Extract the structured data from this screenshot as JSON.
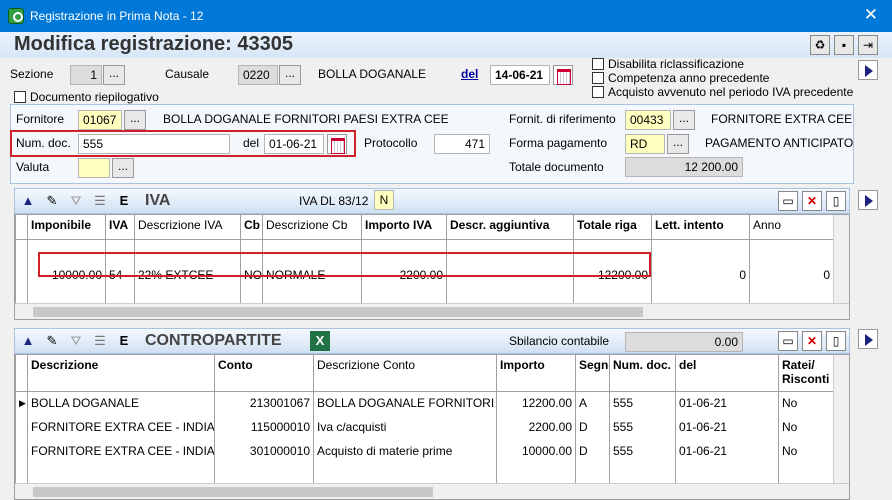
{
  "window": {
    "title": "Registrazione in Prima Nota - 12",
    "close_glyph": "✕"
  },
  "header": {
    "title": "Modifica registrazione:",
    "number": "43305",
    "sezione_label": "Sezione",
    "sezione_value": "1",
    "causale_label": "Causale",
    "causale_code": "0220",
    "causale_desc": "BOLLA DOGANALE",
    "del_label": "del",
    "date_value": "14-06-21",
    "doc_riepilogativo": "Documento riepilogativo",
    "checks": [
      "Disabilita riclassificazione",
      "Competenza anno precedente",
      "Acquisto avvenuto nel periodo IVA precedente"
    ]
  },
  "document": {
    "fornitore_label": "Fornitore",
    "fornitore_code": "01067",
    "fornitore_name": "BOLLA DOGANALE FORNITORI PAESI EXTRA CEE",
    "num_doc_label": "Num. doc.",
    "num_doc_value": "555",
    "del_label": "del",
    "doc_date": "01-06-21",
    "protocollo_label": "Protocollo",
    "protocollo_value": "471",
    "valuta_label": "Valuta",
    "valuta_value": "",
    "fornit_rif_label": "Fornit. di riferimento",
    "fornit_rif_code": "00433",
    "fornit_rif_name": "FORNITORE EXTRA CEE",
    "forma_pag_label": "Forma pagamento",
    "forma_pag_code": "RD",
    "forma_pag_desc": "PAGAMENTO ANTICIPATO",
    "totale_label": "Totale documento",
    "totale_value": "12 200.00"
  },
  "iva": {
    "title": "IVA",
    "dl_label": "IVA DL 83/12",
    "dl_value": "N",
    "columns": [
      "Imponibile",
      "IVA",
      "Descrizione IVA",
      "Cb",
      "Descrizione Cb",
      "Importo IVA",
      "Descr. aggiuntiva",
      "Totale riga",
      "Lett. intento",
      "Anno"
    ],
    "rows": [
      [
        "10000.00",
        "54",
        "22% EXTCEE",
        "NO",
        "NORMALE",
        "2200.00",
        "",
        "12200.00",
        "0",
        "0"
      ]
    ]
  },
  "contropartite": {
    "title": "CONTROPARTITE",
    "sbilancio_label": "Sbilancio contabile",
    "sbilancio_value": "0.00",
    "columns": [
      "Descrizione",
      "Conto",
      "Descrizione Conto",
      "Importo",
      "Segno",
      "Num. doc.",
      "del",
      "Ratei/ Risconti"
    ],
    "rows": [
      [
        "BOLLA DOGANALE",
        "213001067",
        "BOLLA DOGANALE FORNITORI P",
        "12200.00",
        "A",
        "555",
        "01-06-21",
        "No"
      ],
      [
        "FORNITORE EXTRA CEE - INDIA",
        "115000010",
        "Iva c/acquisti",
        "2200.00",
        "D",
        "555",
        "01-06-21",
        "No"
      ],
      [
        "FORNITORE EXTRA CEE - INDIA",
        "301000010",
        "Acquisto di materie prime",
        "10000.00",
        "D",
        "555",
        "01-06-21",
        "No"
      ]
    ]
  },
  "colors": {
    "titlebar": "#0078d7",
    "highlight": "#d0202a",
    "yellow_field": "#ffffc0"
  },
  "icons": [
    "app-icon",
    "recycle-icon",
    "save-icon",
    "exit-icon",
    "calendar-icon",
    "up-arrow-icon",
    "edit-icon",
    "filter-icon",
    "list-icon",
    "excel-icon",
    "delete-icon",
    "new-doc-icon",
    "next-arrow-icon"
  ]
}
